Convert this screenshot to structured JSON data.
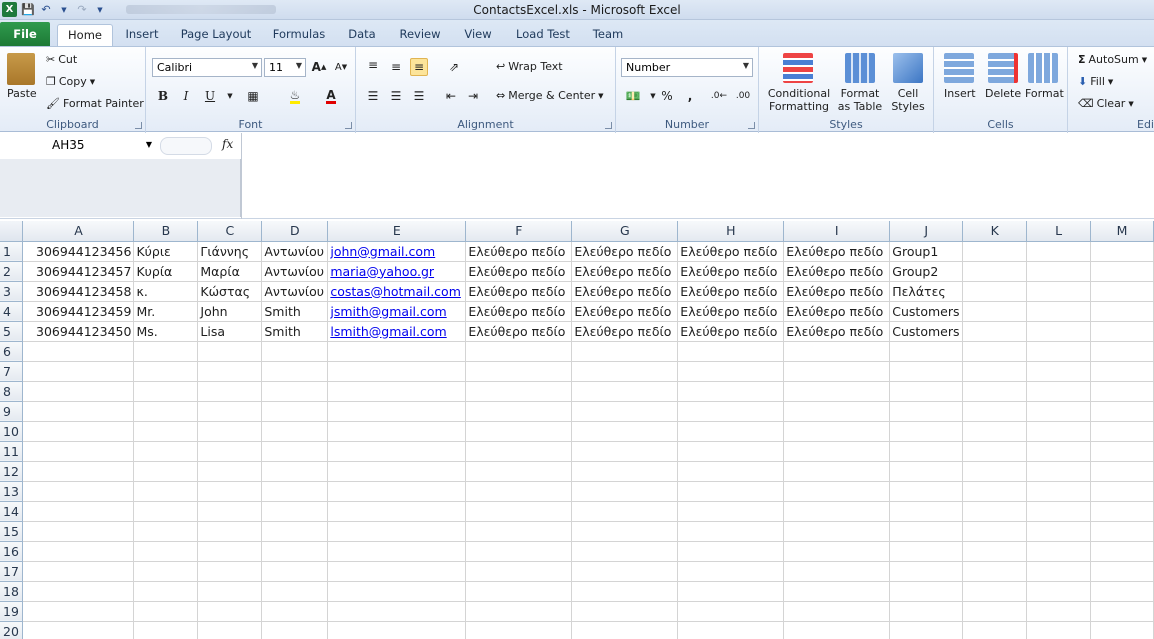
{
  "window": {
    "title": "ContactsExcel.xls  -  Microsoft Excel"
  },
  "tabs": [
    "File",
    "Home",
    "Insert",
    "Page Layout",
    "Formulas",
    "Data",
    "Review",
    "View",
    "Load Test",
    "Team"
  ],
  "clipboard": {
    "paste": "Paste",
    "cut": "Cut",
    "copy": "Copy",
    "format_painter": "Format Painter",
    "label": "Clipboard"
  },
  "font": {
    "name": "Calibri",
    "size": "11",
    "bold": "B",
    "italic": "I",
    "underline": "U",
    "label": "Font"
  },
  "alignment": {
    "wrap": "Wrap Text",
    "merge": "Merge & Center",
    "label": "Alignment"
  },
  "number": {
    "format": "Number",
    "percent": "%",
    "comma": ",",
    "label": "Number"
  },
  "styles": {
    "conditional_1": "Conditional",
    "conditional_2": "Formatting",
    "format_table_1": "Format",
    "format_table_2": "as Table",
    "cell_styles_1": "Cell",
    "cell_styles_2": "Styles",
    "label": "Styles"
  },
  "cells": {
    "insert": "Insert",
    "delete": "Delete",
    "format": "Format",
    "label": "Cells"
  },
  "editing": {
    "autosum": "AutoSum",
    "fill": "Fill",
    "clear": "Clear",
    "label": "Edi"
  },
  "formula_bar": {
    "name_box": "AH35",
    "fx": "fx"
  },
  "colors": {
    "file_tab": "#1d7a36",
    "link": "#0000ee",
    "header_bg": "#e4e9f0"
  },
  "sheet": {
    "columns": [
      "A",
      "B",
      "C",
      "D",
      "E",
      "F",
      "G",
      "H",
      "I",
      "J",
      "K",
      "L",
      "M"
    ],
    "row_numbers": [
      "1",
      "2",
      "3",
      "4",
      "5",
      "6",
      "7",
      "8",
      "9",
      "10",
      "11",
      "12",
      "13",
      "14",
      "15",
      "16",
      "17",
      "18",
      "19",
      "20"
    ],
    "rows": [
      [
        "306944123456",
        "Κύριε",
        "Γιάννης",
        "Αντωνίου",
        "john@gmail.com",
        "Ελεύθερο πεδίο",
        "Ελεύθερο πεδίο",
        "Ελεύθερο πεδίο",
        "Ελεύθερο πεδίο",
        "Group1",
        "",
        "",
        ""
      ],
      [
        "306944123457",
        "Κυρία",
        "Μαρία",
        "Αντωνίου",
        "maria@yahoo.gr",
        "Ελεύθερο πεδίο",
        "Ελεύθερο πεδίο",
        "Ελεύθερο πεδίο",
        "Ελεύθερο πεδίο",
        "Group2",
        "",
        "",
        ""
      ],
      [
        "306944123458",
        "κ.",
        "Κώστας",
        "Αντωνίου",
        "costas@hotmail.com",
        "Ελεύθερο πεδίο",
        "Ελεύθερο πεδίο",
        "Ελεύθερο πεδίο",
        "Ελεύθερο πεδίο",
        "Πελάτες",
        "",
        "",
        ""
      ],
      [
        "306944123459",
        "Mr.",
        "John",
        "Smith",
        "jsmith@gmail.com",
        "Ελεύθερο πεδίο",
        "Ελεύθερο πεδίο",
        "Ελεύθερο πεδίο",
        "Ελεύθερο πεδίο",
        "Customers",
        "",
        "",
        ""
      ],
      [
        "306944123450",
        "Ms.",
        "Lisa",
        "Smith",
        "lsmith@gmail.com",
        "Ελεύθερο πεδίο",
        "Ελεύθερο πεδίο",
        "Ελεύθερο πεδίο",
        "Ελεύθερο πεδίο",
        "Customers",
        "",
        "",
        ""
      ]
    ]
  }
}
